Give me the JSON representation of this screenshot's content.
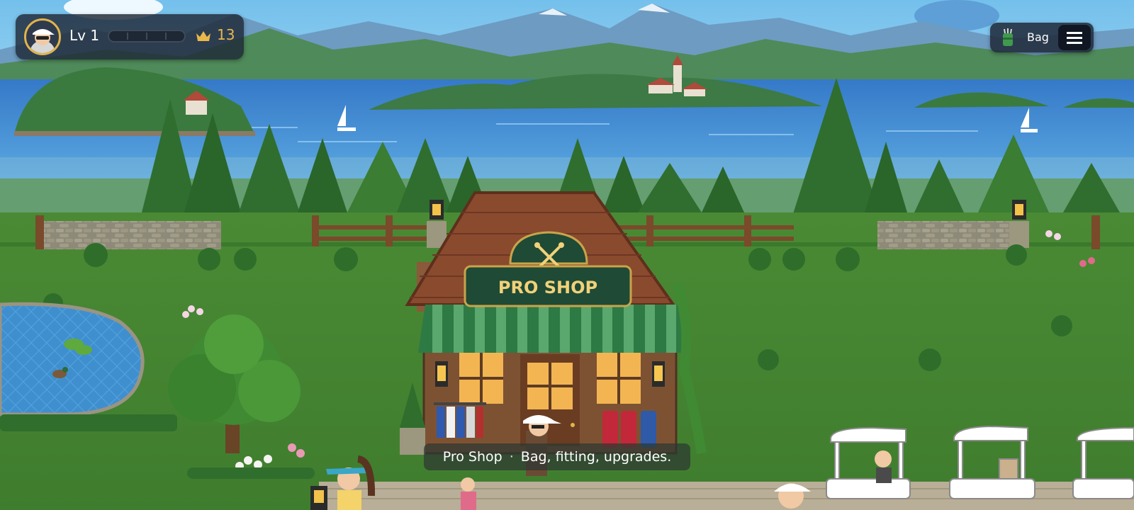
{
  "hud": {
    "level_label": "Lv 1",
    "xp_progress": 0.0,
    "coin_count": "13",
    "avatar_icon": "golfer-avatar-icon",
    "crown_icon": "crown-icon"
  },
  "bag_button": {
    "label": "Bag",
    "icon": "golf-bag-icon"
  },
  "menu_button": {
    "icon": "hamburger-menu-icon"
  },
  "location_caption": {
    "place": "Pro Shop",
    "separator": "·",
    "description": "Bag, fitting, upgrades."
  },
  "scene": {
    "sign_text": "PRO SHOP",
    "colors": {
      "sky": "#8fd0ee",
      "lake": "#3f90d6",
      "grass": "#4f8a3a",
      "awning_green": "#2e7a44",
      "roof": "#8a4a2e",
      "sign_bg": "#1f4a35",
      "sign_text": "#f1d17a",
      "gold_accent": "#e2b44a"
    }
  }
}
